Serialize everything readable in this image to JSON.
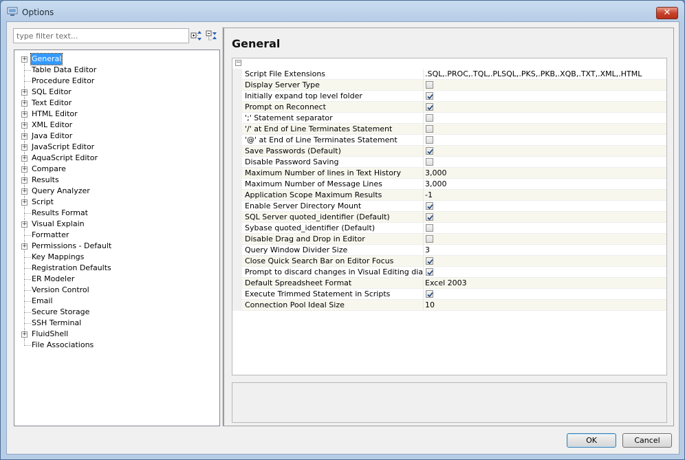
{
  "window": {
    "title": "Options",
    "close_glyph": "✕"
  },
  "filter": {
    "placeholder": "type filter text..."
  },
  "tree": {
    "items": [
      {
        "label": "General",
        "expandable": true,
        "selected": true
      },
      {
        "label": "Table Data Editor",
        "expandable": false
      },
      {
        "label": "Procedure Editor",
        "expandable": false
      },
      {
        "label": "SQL Editor",
        "expandable": true
      },
      {
        "label": "Text Editor",
        "expandable": true
      },
      {
        "label": "HTML Editor",
        "expandable": true
      },
      {
        "label": "XML Editor",
        "expandable": true
      },
      {
        "label": "Java Editor",
        "expandable": true
      },
      {
        "label": "JavaScript Editor",
        "expandable": true
      },
      {
        "label": "AquaScript Editor",
        "expandable": true
      },
      {
        "label": "Compare",
        "expandable": true
      },
      {
        "label": "Results",
        "expandable": true
      },
      {
        "label": "Query Analyzer",
        "expandable": true
      },
      {
        "label": "Script",
        "expandable": true
      },
      {
        "label": "Results Format",
        "expandable": false
      },
      {
        "label": "Visual Explain",
        "expandable": true
      },
      {
        "label": "Formatter",
        "expandable": false
      },
      {
        "label": "Permissions - Default",
        "expandable": true
      },
      {
        "label": "Key Mappings",
        "expandable": false
      },
      {
        "label": "Registration Defaults",
        "expandable": false
      },
      {
        "label": "ER Modeler",
        "expandable": false
      },
      {
        "label": "Version Control",
        "expandable": false
      },
      {
        "label": "Email",
        "expandable": false
      },
      {
        "label": "Secure Storage",
        "expandable": false
      },
      {
        "label": "SSH Terminal",
        "expandable": false
      },
      {
        "label": "FluidShell",
        "expandable": true
      },
      {
        "label": "File Associations",
        "expandable": false
      }
    ]
  },
  "panel": {
    "title": "General",
    "properties": [
      {
        "name": "Script File Extensions",
        "type": "text",
        "value": ".SQL,.PROC,.TQL,.PLSQL,.PKS,.PKB,.XQB,.TXT,.XML,.HTML"
      },
      {
        "name": "Display Server Type",
        "type": "checkbox",
        "checked": false
      },
      {
        "name": "Initially expand top level folder",
        "type": "checkbox",
        "checked": true
      },
      {
        "name": "Prompt on Reconnect",
        "type": "checkbox",
        "checked": true
      },
      {
        "name": "';' Statement separator",
        "type": "checkbox",
        "checked": false
      },
      {
        "name": "'/' at End of Line Terminates Statement",
        "type": "checkbox",
        "checked": false
      },
      {
        "name": "'@' at End of Line Terminates Statement",
        "type": "checkbox",
        "checked": false
      },
      {
        "name": "Save Passwords (Default)",
        "type": "checkbox",
        "checked": true
      },
      {
        "name": "Disable Password Saving",
        "type": "checkbox",
        "checked": false
      },
      {
        "name": "Maximum Number of lines in Text History",
        "type": "text",
        "value": "3,000"
      },
      {
        "name": "Maximum Number of Message Lines",
        "type": "text",
        "value": "3,000"
      },
      {
        "name": "Application Scope Maximum Results",
        "type": "text",
        "value": "-1"
      },
      {
        "name": "Enable Server Directory Mount",
        "type": "checkbox",
        "checked": true
      },
      {
        "name": "SQL Server quoted_identifier (Default)",
        "type": "checkbox",
        "checked": true
      },
      {
        "name": "Sybase quoted_identifier (Default)",
        "type": "checkbox",
        "checked": false
      },
      {
        "name": "Disable Drag and Drop in Editor",
        "type": "checkbox",
        "checked": false
      },
      {
        "name": "Query Window Divider Size",
        "type": "text",
        "value": "3"
      },
      {
        "name": "Close Quick Search Bar on Editor Focus",
        "type": "checkbox",
        "checked": true
      },
      {
        "name": "Prompt to discard changes in Visual Editing dialogs",
        "type": "checkbox",
        "checked": true
      },
      {
        "name": "Default Spreadsheet Format",
        "type": "text",
        "value": "Excel 2003"
      },
      {
        "name": "Execute Trimmed Statement in Scripts",
        "type": "checkbox",
        "checked": true
      },
      {
        "name": "Connection Pool Ideal Size",
        "type": "text",
        "value": "10"
      }
    ]
  },
  "buttons": {
    "ok": "OK",
    "cancel": "Cancel"
  },
  "icons": {
    "app": "options-window-icon",
    "expand_all": "expand-all-icon",
    "collapse_all": "collapse-all-icon",
    "plus": "+",
    "minus": "−"
  },
  "colors": {
    "selection": "#3399ff",
    "title_bar": "#b7cde6",
    "close": "#c7432c"
  }
}
